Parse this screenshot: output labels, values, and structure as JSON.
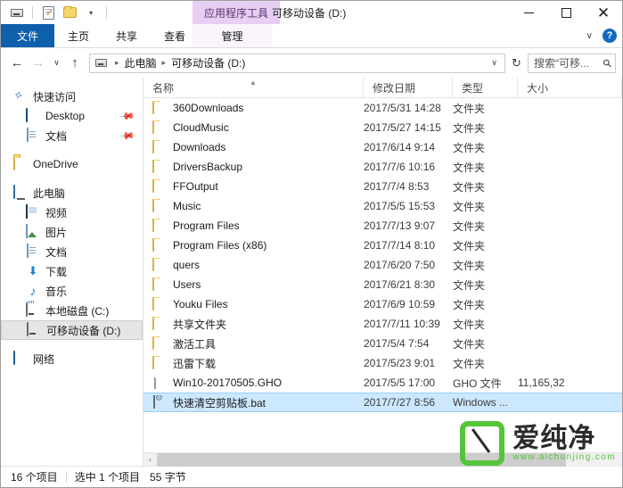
{
  "titlebar": {
    "quick_access": [
      {
        "name": "drive-properties-icon",
        "label": "可移动设备"
      },
      {
        "name": "properties-icon",
        "label": "属性"
      },
      {
        "name": "new-folder-icon",
        "label": "新建文件夹"
      },
      {
        "name": "customize-caret-icon",
        "label": "▾"
      }
    ],
    "context_tab_label": "应用程序工具",
    "window_title": "可移动设备 (D:)",
    "minimize_label": "最小化",
    "maximize_label": "最大化",
    "close_label": "关闭"
  },
  "ribbon": {
    "tabs": [
      {
        "label": "文件",
        "active": true
      },
      {
        "label": "主页",
        "active": false
      },
      {
        "label": "共享",
        "active": false
      },
      {
        "label": "查看",
        "active": false
      }
    ],
    "context_tab": {
      "label": "管理"
    },
    "collapse_caret": "∨",
    "help_label": "?"
  },
  "addressbar": {
    "back_label": "←",
    "forward_label": "→",
    "recent_label": "∨",
    "up_label": "↑",
    "breadcrumbs": [
      "此电脑",
      "可移动设备 (D:)"
    ],
    "dropdown_caret": "∨",
    "refresh_label": "↻",
    "search_placeholder": "搜索“可移...",
    "search_value": ""
  },
  "navpane": {
    "groups": [
      {
        "header": {
          "label": "快速访问",
          "icon": "star-icon"
        },
        "items": [
          {
            "label": "Desktop",
            "icon": "desktop-icon",
            "pinned": true
          },
          {
            "label": "文档",
            "icon": "document-icon",
            "pinned": true
          }
        ]
      },
      {
        "header": {
          "label": "OneDrive",
          "icon": "onedrive-folder-icon"
        },
        "items": []
      },
      {
        "header": {
          "label": "此电脑",
          "icon": "this-pc-icon"
        },
        "items": [
          {
            "label": "视频",
            "icon": "videos-icon",
            "pinned": false
          },
          {
            "label": "图片",
            "icon": "pictures-icon",
            "pinned": false
          },
          {
            "label": "文档",
            "icon": "document-icon",
            "pinned": false
          },
          {
            "label": "下载",
            "icon": "downloads-icon",
            "pinned": false
          },
          {
            "label": "音乐",
            "icon": "music-icon",
            "pinned": false
          },
          {
            "label": "本地磁盘 (C:)",
            "icon": "local-disk-icon",
            "pinned": false
          },
          {
            "label": "可移动设备 (D:)",
            "icon": "removable-drive-icon",
            "pinned": false,
            "selected": true
          }
        ]
      },
      {
        "header": {
          "label": "网络",
          "icon": "network-icon"
        },
        "items": []
      }
    ],
    "pin_glyph": "📌"
  },
  "filelist": {
    "columns": [
      {
        "label": "名称",
        "sorted": true,
        "sort_caret": "▲"
      },
      {
        "label": "修改日期",
        "sorted": false
      },
      {
        "label": "类型",
        "sorted": false
      },
      {
        "label": "大小",
        "sorted": false
      }
    ],
    "rows": [
      {
        "name": "360Downloads",
        "date": "2017/5/31 14:28",
        "type": "文件夹",
        "size": "",
        "icon": "folder-icon",
        "selected": false
      },
      {
        "name": "CloudMusic",
        "date": "2017/5/27 14:15",
        "type": "文件夹",
        "size": "",
        "icon": "folder-icon",
        "selected": false
      },
      {
        "name": "Downloads",
        "date": "2017/6/14 9:14",
        "type": "文件夹",
        "size": "",
        "icon": "folder-icon",
        "selected": false
      },
      {
        "name": "DriversBackup",
        "date": "2017/7/6 10:16",
        "type": "文件夹",
        "size": "",
        "icon": "folder-icon",
        "selected": false
      },
      {
        "name": "FFOutput",
        "date": "2017/7/4 8:53",
        "type": "文件夹",
        "size": "",
        "icon": "folder-icon",
        "selected": false
      },
      {
        "name": "Music",
        "date": "2017/5/5 15:53",
        "type": "文件夹",
        "size": "",
        "icon": "folder-icon",
        "selected": false
      },
      {
        "name": "Program Files",
        "date": "2017/7/13 9:07",
        "type": "文件夹",
        "size": "",
        "icon": "folder-icon",
        "selected": false
      },
      {
        "name": "Program Files (x86)",
        "date": "2017/7/14 8:10",
        "type": "文件夹",
        "size": "",
        "icon": "folder-icon",
        "selected": false
      },
      {
        "name": "quers",
        "date": "2017/6/20 7:50",
        "type": "文件夹",
        "size": "",
        "icon": "folder-icon",
        "selected": false
      },
      {
        "name": "Users",
        "date": "2017/6/21 8:30",
        "type": "文件夹",
        "size": "",
        "icon": "folder-icon",
        "selected": false
      },
      {
        "name": "Youku Files",
        "date": "2017/6/9 10:59",
        "type": "文件夹",
        "size": "",
        "icon": "folder-icon",
        "selected": false
      },
      {
        "name": "共享文件夹",
        "date": "2017/7/11 10:39",
        "type": "文件夹",
        "size": "",
        "icon": "folder-icon",
        "selected": false
      },
      {
        "name": "激活工具",
        "date": "2017/5/4 7:54",
        "type": "文件夹",
        "size": "",
        "icon": "folder-icon",
        "selected": false
      },
      {
        "name": "迅雷下载",
        "date": "2017/5/23 9:01",
        "type": "文件夹",
        "size": "",
        "icon": "folder-icon",
        "selected": false
      },
      {
        "name": "Win10-20170505.GHO",
        "date": "2017/5/5 17:00",
        "type": "GHO 文件",
        "size": "11,165,32",
        "icon": "generic-file-icon",
        "selected": false
      },
      {
        "name": "快速清空剪贴板.bat",
        "date": "2017/7/27 8:56",
        "type": "Windows ...",
        "size": "",
        "icon": "batch-file-icon",
        "selected": true
      }
    ],
    "scroll_left_arrow": "‹",
    "scroll_right_arrow": "›"
  },
  "watermark": {
    "brand": "爱纯净",
    "url": "www.aichunjing.com",
    "accent_color": "#55c43a"
  },
  "statusbar": {
    "item_count": "16 个项目",
    "selection": "选中 1 个项目",
    "selection_size": "55 字节"
  },
  "colors": {
    "file_tab_blue": "#0e60ad",
    "context_purple": "#e6cff2",
    "selection_blue": "#cce8ff",
    "folder_yellow": "#f7d46a"
  }
}
